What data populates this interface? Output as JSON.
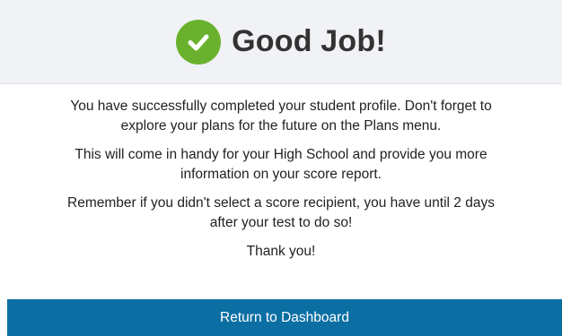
{
  "header": {
    "icon": "check-circle-icon",
    "icon_color": "#6ab22e",
    "title": "Good Job!"
  },
  "body": {
    "paragraphs": [
      "You have successfully completed your student profile. Don't forget to explore your plans for the future on the Plans menu.",
      "This will come in handy for your High School and provide you more information on your score report.",
      "Remember if you didn't select a score recipient, you have until 2 days after your test to do so!",
      "Thank you!"
    ]
  },
  "footer": {
    "button_label": "Return to Dashboard",
    "button_color": "#0b6fa4"
  }
}
